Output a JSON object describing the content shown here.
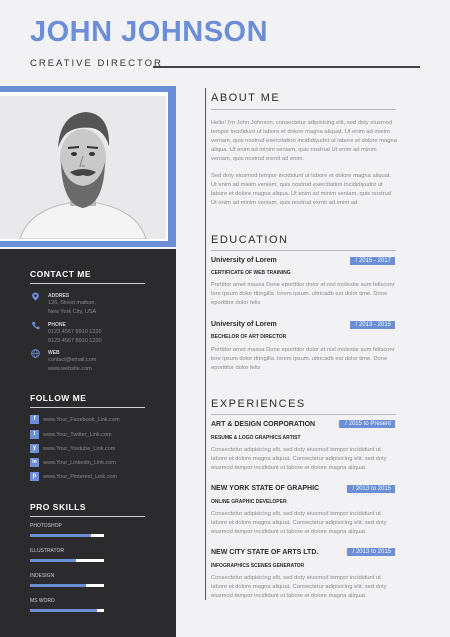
{
  "header": {
    "name": "JOHN JOHNSON",
    "role": "CREATIVE DIRECTOR"
  },
  "about": {
    "title": "ABOUT ME",
    "para1": "Hello! I'm John Johnson, consectetur adipisicing elit, sed doty eiusmod tempor incididunt ut labore et dolore magna aliquat. Ut enim ad mieim veniam, quis nostrud exercitation incididiyudnt ut labore et dolore magna aliqua. Ut enim ad minim veniam, quis nostrud Ut enim ad minim veniam, quis nostrud exrnit ad enim.",
    "para2": "Sed doty eiusmod tempor incididunt ut labore et dolore magna aliquat. Ut enim ad mieim veniam, quis nostrud exercitation incididiyudnt ut labore et dolore magna aliqua. Ut enim ad minim veniam, quis nostrud Ut enim ad minim veniam, quis nostrud exrnit ad enim ad"
  },
  "contact": {
    "title": "CONTACT ME",
    "address_label": "ADDRES",
    "address_lines": [
      "126, Street maibon,",
      "New York City, USA"
    ],
    "phone_label": "PHONE",
    "phone_lines": [
      "0123 4567 8910 1230",
      "0123 4567 8910 1230"
    ],
    "web_label": "WEB",
    "web_lines": [
      "contact@email.com",
      "www.website.com"
    ]
  },
  "follow": {
    "title": "FOLLOW ME",
    "items": [
      {
        "icon": "f",
        "text": "www.Your_Facebook_Link.com"
      },
      {
        "icon": "t",
        "text": "www.Your_Twitter_Link.com"
      },
      {
        "icon": "y",
        "text": "www.Your_Youtube_Link.com"
      },
      {
        "icon": "in",
        "text": "www.Your_Linkedin_Link.com"
      },
      {
        "icon": "p",
        "text": "www.Your_Pinterest_Link.com"
      }
    ]
  },
  "skills": {
    "title": "PRO SKILLS",
    "items": [
      {
        "label": "PHOTOSHOP",
        "level": 0.82
      },
      {
        "label": "ILLUSTRATOR",
        "level": 0.62
      },
      {
        "label": "INDESIGN",
        "level": 0.75
      },
      {
        "label": "MS WORD",
        "level": 0.9
      }
    ]
  },
  "education": {
    "title": "EDUCATION",
    "items": [
      {
        "school": "University of Lorem",
        "date": "/ 2015 - 2017",
        "degree": "CERTIFICATE OF WEB TRAINING",
        "text": "Porttitor amet massa Done eporttitor dolor et nisl molestie sum felisconr lore ipsum dolor tfringilla. lorem ipsum. ultricadb est dolor time. Done eporttitor dolor felis"
      },
      {
        "school": "University of Lorem",
        "date": "/ 2013 - 2015",
        "degree": "BECHELOR OF ART DIRECTOR",
        "text": "Porttitor amet massa Done eporttitor dolor et nisl molestie sum felisconr lore ipsum dolor tfringilla. lorem ipsum. ultricadb est dolor time. Done eporttitor dolor felis"
      }
    ]
  },
  "experiences": {
    "title": "EXPERIENCES",
    "items": [
      {
        "company": "ART & DESIGN CORPORATION",
        "date": "/ 2015 to Present",
        "position": "RESUME & LOGO GRAPHICS ARTIST",
        "text": "Consectetur adipisicing elit, sed doty eiusmod tempor incididunt ut labore et dolore magna aliquat. Consectetur adipisicing elit, sed doty eiusmod tempor incididunt ut labore et dolore magna aliquat."
      },
      {
        "company": "NEW YORK STATE OF GRAPHIC",
        "date": "/ 2013 to 2015",
        "position": "ONLINE GRAPHIC DEVELOPER",
        "text": "Consectetur adipisicing elit, sed doty eiusmod tempor incididunt ut labore et dolore magna aliquat. Consectetur adipisicing elit, sed doty eiusmod tempor incididunt ut labore et dolore magna aliquat."
      },
      {
        "company": "NEW CITY STATE OF ARTS LTD.",
        "date": "/ 2013 to 2015",
        "position": "INFOGRAPHICS SCENES GENERATOR",
        "text": "Consectetur adipisicing elit, sed doty eiusmod tempor incididunt ut labore et dolore magna aliquat. Consectetur adipisicing elit, sed doty eiusmod tempor incididunt ut labore et dolore magna aliquat."
      }
    ]
  },
  "colors": {
    "accent": "#6b8ed6",
    "sidebar": "#2b2b2d"
  }
}
